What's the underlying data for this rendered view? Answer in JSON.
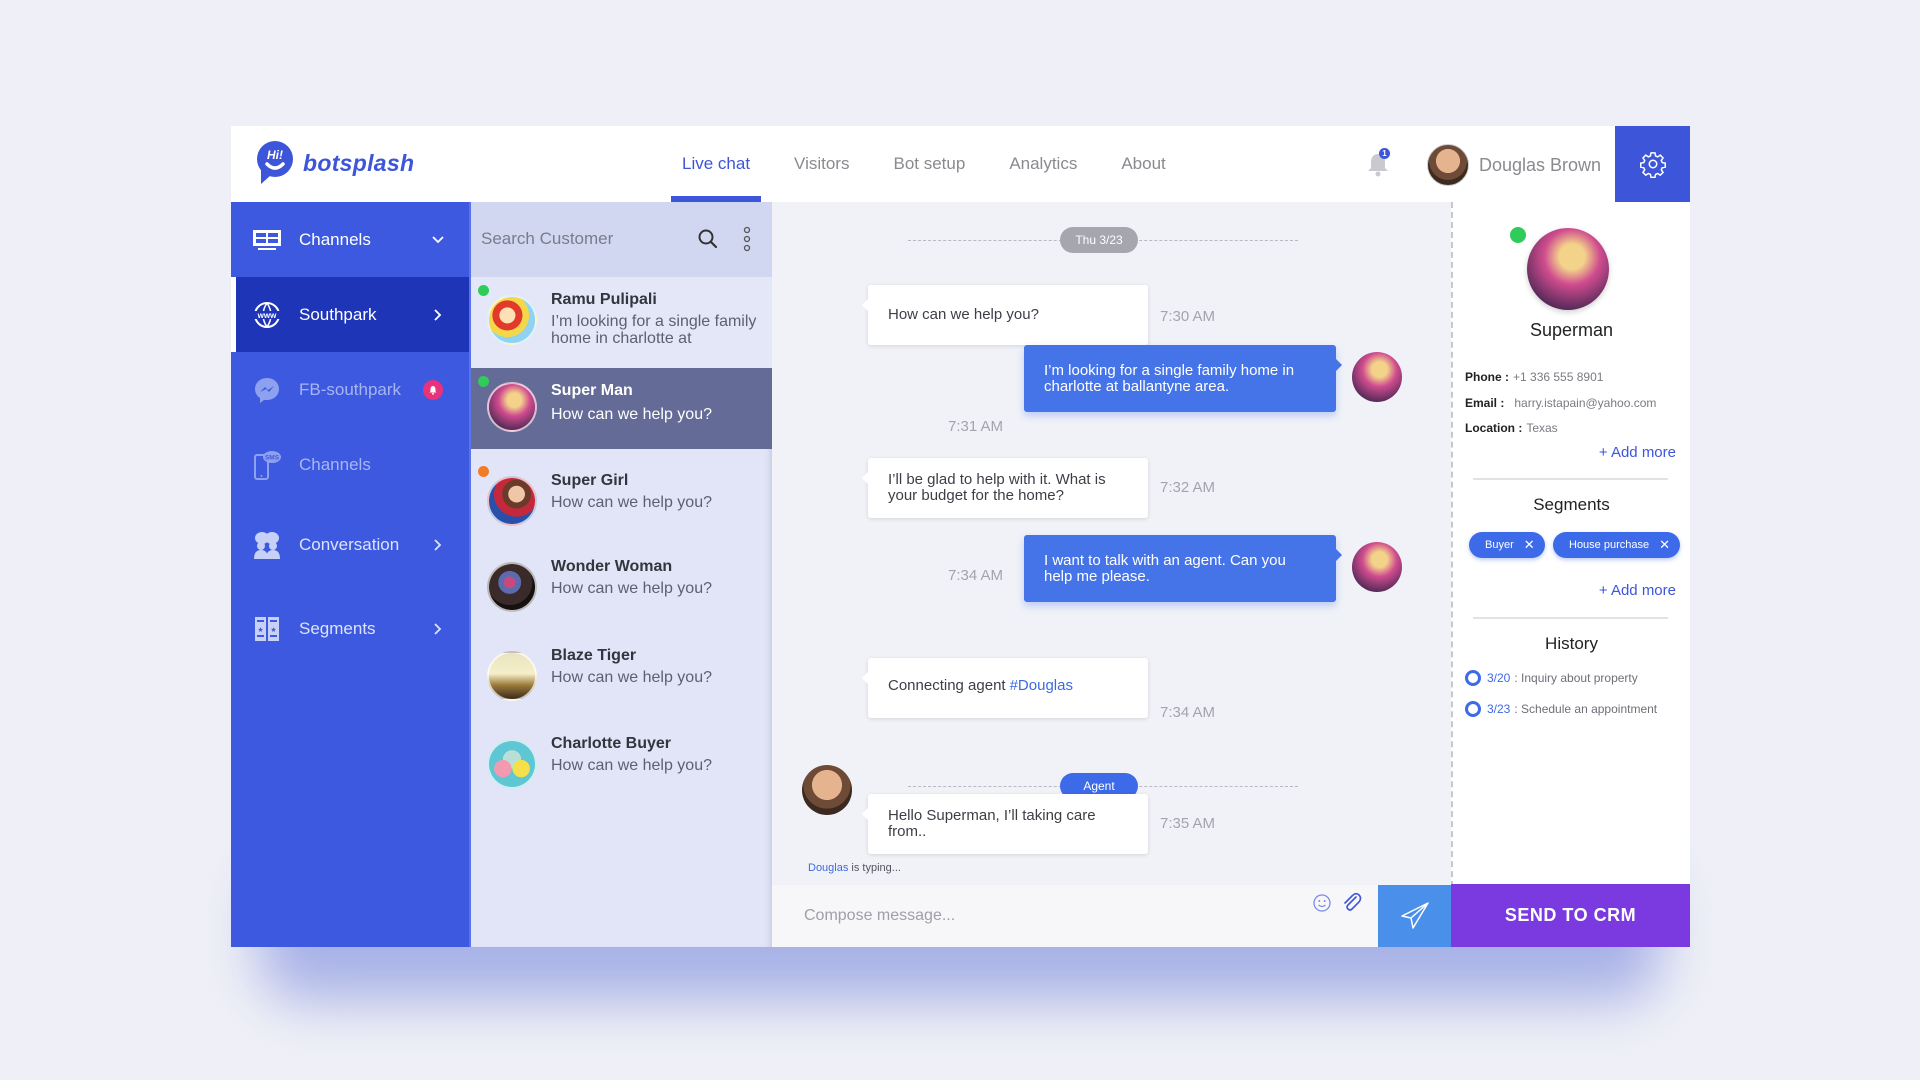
{
  "brand": {
    "name": "botsplash",
    "badge": "Hi!"
  },
  "nav": {
    "tabs": [
      {
        "label": "Live chat",
        "active": true
      },
      {
        "label": "Visitors",
        "active": false
      },
      {
        "label": "Bot setup",
        "active": false
      },
      {
        "label": "Analytics",
        "active": false
      },
      {
        "label": "About",
        "active": false
      }
    ]
  },
  "header": {
    "notification_count": "1",
    "user_name": "Douglas Brown"
  },
  "sidebar": {
    "items": [
      {
        "label": "Channels",
        "icon": "channels-icon",
        "chevron": "down"
      },
      {
        "label": "Southpark",
        "icon": "www-globe-icon",
        "chevron": "right",
        "active": true
      },
      {
        "label": "FB-southpark",
        "icon": "messenger-icon",
        "badge": "bell"
      },
      {
        "label": "Channels",
        "icon": "sms-phone-icon"
      },
      {
        "label": "Conversation",
        "icon": "conversation-people-icon",
        "chevron": "right"
      },
      {
        "label": "Segments",
        "icon": "segments-icon",
        "chevron": "right"
      }
    ]
  },
  "contacts": {
    "search_placeholder": "Search Customer",
    "items": [
      {
        "name": "Ramu Pulipali",
        "message": "I’m looking for a single family home in charlotte at",
        "status": "online",
        "status_color": "#2fcc5a"
      },
      {
        "name": "Super Man",
        "message": "How can we help you?",
        "status": "online",
        "status_color": "#2fcc5a",
        "selected": true
      },
      {
        "name": "Super Girl",
        "message": "How can we help you?",
        "status": "away",
        "status_color": "#f47b25"
      },
      {
        "name": "Wonder Woman",
        "message": "How can we help you?"
      },
      {
        "name": "Blaze Tiger",
        "message": "How can we help you?"
      },
      {
        "name": "Charlotte Buyer",
        "message": "How can we help you?"
      }
    ]
  },
  "chat": {
    "date_label": "Thu 3/23",
    "agent_label": "Agent",
    "messages": [
      {
        "from": "bot",
        "text": "How can we help you?",
        "time": "7:30 AM"
      },
      {
        "from": "user",
        "text": "I’m looking for a single family home in charlotte at ballantyne area.",
        "time": "7:31 AM"
      },
      {
        "from": "bot",
        "text": "I’ll be glad to help with it. What is your budget for the home?",
        "time": "7:32 AM"
      },
      {
        "from": "user",
        "text": "I want to talk with an agent. Can you help me please.",
        "time": "7:34 AM"
      },
      {
        "from": "bot",
        "text": "Connecting agent ",
        "mention": "#Douglas",
        "time": "7:34 AM"
      },
      {
        "from": "agent",
        "text": "Hello Superman, I’ll taking care from..",
        "time": "7:35 AM"
      }
    ],
    "typing_user": "Douglas",
    "typing_suffix": " is typing...",
    "compose_placeholder": "Compose message..."
  },
  "profile": {
    "name": "Superman",
    "phone_label": "Phone :",
    "phone": "+1 336 555 8901",
    "email_label": "Email :",
    "email": "harry.istapain@yahoo.com",
    "location_label": "Location :",
    "location": "Texas",
    "add_more": "+ Add more",
    "segments_title": "Segments",
    "segments": [
      "Buyer",
      "House purchase"
    ],
    "history_title": "History",
    "history": [
      {
        "date": "3/20",
        "text": ": Inquiry about property"
      },
      {
        "date": "3/23",
        "text": ": Schedule an appointment"
      }
    ],
    "send_crm_label": "SEND TO CRM"
  },
  "colors": {
    "primary": "#3d55d9",
    "sidebar": "#3d59df",
    "sidebar_active": "#1f35b8",
    "user_bubble": "#4573e8",
    "send_button": "#4a90ea",
    "crm_button": "#7a3ae0",
    "online": "#2fcc5a",
    "away": "#f47b25",
    "alert": "#e8337a"
  }
}
